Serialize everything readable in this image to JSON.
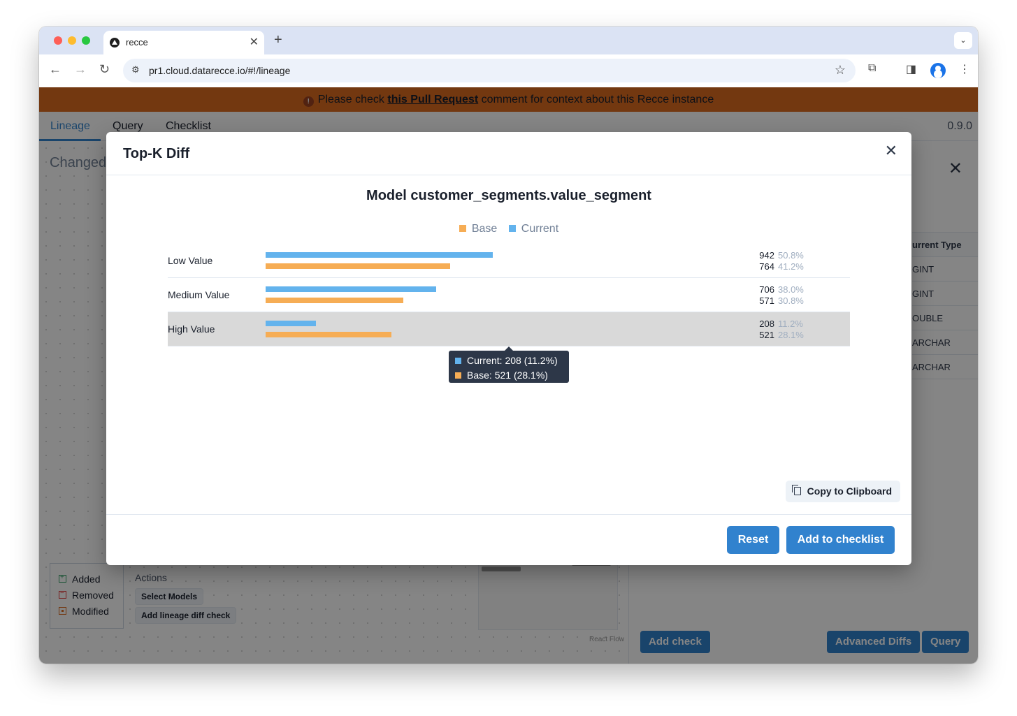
{
  "browser": {
    "tab_title": "recce",
    "url": "pr1.cloud.datarecce.io/#!/lineage"
  },
  "banner": {
    "prefix": "Please check ",
    "link": "this Pull Request",
    "suffix": " comment for context about this Recce instance"
  },
  "app": {
    "tabs": [
      "Lineage",
      "Query",
      "Checklist"
    ],
    "version": "0.9.0"
  },
  "background": {
    "changed_label": "Changed",
    "legend": [
      "Added",
      "Removed",
      "Modified"
    ],
    "actions_label": "Actions",
    "select_models": "Select Models",
    "add_lineage_diff": "Add lineage diff check",
    "react_flow": "React Flow",
    "right_panel": {
      "column_header": "urrent Type",
      "types": [
        "GINT",
        "GINT",
        "OUBLE",
        "ARCHAR",
        "ARCHAR"
      ],
      "add_check": "Add check",
      "advanced_diffs": "Advanced Diffs",
      "query": "Query"
    }
  },
  "modal": {
    "title": "Top-K Diff",
    "copy_label": "Copy to Clipboard",
    "reset_label": "Reset",
    "add_to_checklist_label": "Add to checklist"
  },
  "colors": {
    "base": "#f6ad55",
    "current": "#63b3ed",
    "accent": "#3182ce",
    "banner": "#dd6b20"
  },
  "chart_data": {
    "type": "bar",
    "title": "Model customer_segments.value_segment",
    "legend": [
      "Base",
      "Current"
    ],
    "categories": [
      "Low Value",
      "Medium Value",
      "High Value"
    ],
    "series": [
      {
        "name": "Current",
        "values": [
          942,
          706,
          208
        ],
        "percents": [
          "50.8%",
          "38.0%",
          "11.2%"
        ]
      },
      {
        "name": "Base",
        "values": [
          764,
          571,
          521
        ],
        "percents": [
          "41.2%",
          "30.8%",
          "28.1%"
        ]
      }
    ],
    "xlim": [
      0,
      1855
    ],
    "tooltip": {
      "category": "High Value",
      "current": "Current: 208 (11.2%)",
      "base": "Base: 521 (28.1%)"
    }
  }
}
